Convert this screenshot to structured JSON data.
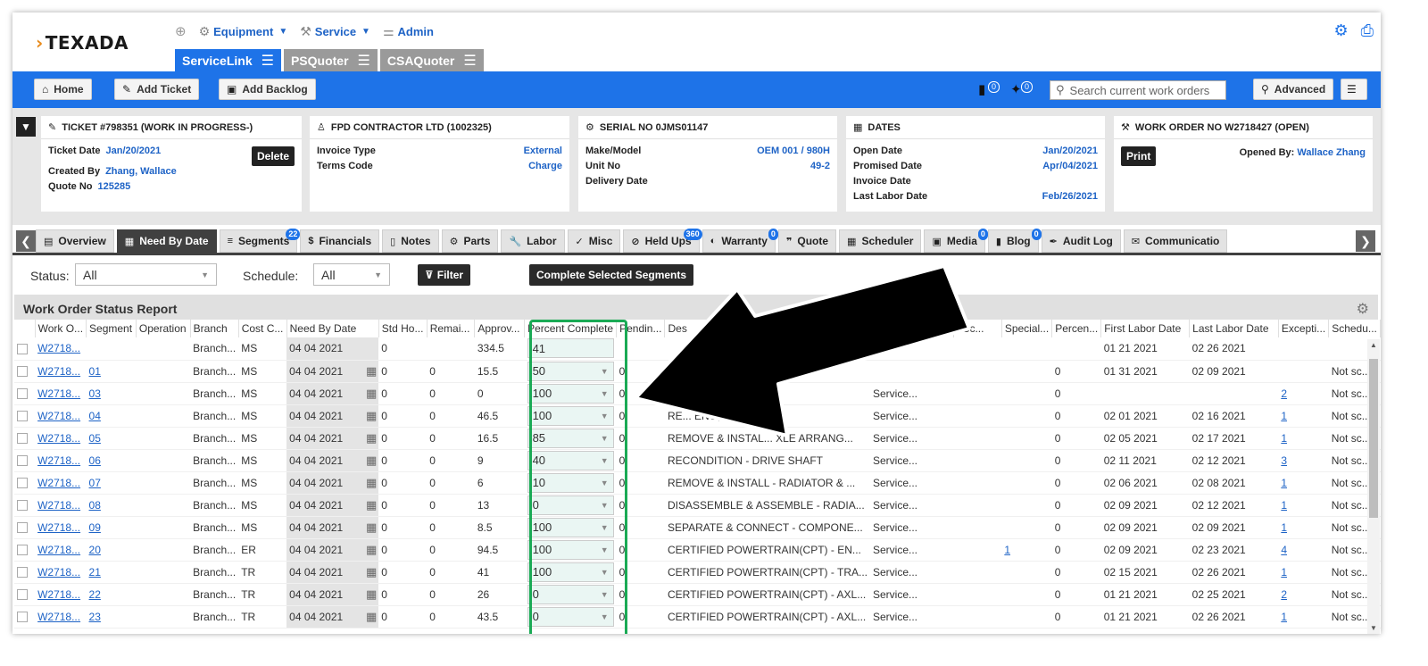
{
  "brand": {
    "logo": "TEXADA"
  },
  "topnav": [
    {
      "label": "Equipment",
      "icon": "gear-link-icon",
      "caret": true
    },
    {
      "label": "Service",
      "icon": "tools-icon",
      "caret": true
    },
    {
      "label": "Admin",
      "icon": "sliders-icon",
      "caret": false
    }
  ],
  "app_tabs": [
    {
      "label": "ServiceLink",
      "active": true
    },
    {
      "label": "PSQuoter",
      "active": false
    },
    {
      "label": "CSAQuoter",
      "active": false
    }
  ],
  "toolbar": {
    "home": "Home",
    "add_ticket": "Add Ticket",
    "add_backlog": "Add Backlog",
    "badge1": "0",
    "badge2": "0",
    "search_placeholder": "Search current work orders",
    "advanced": "Advanced"
  },
  "cards": {
    "ticket": {
      "title": "TICKET #798351 (WORK IN PROGRESS-)",
      "ticket_date_label": "Ticket Date",
      "ticket_date": "Jan/20/2021",
      "created_by_label": "Created By",
      "created_by": "Zhang, Wallace",
      "quote_no_label": "Quote No",
      "quote_no": "125285",
      "delete": "Delete"
    },
    "customer": {
      "title": "FPD CONTRACTOR LTD (1002325)",
      "invoice_type_label": "Invoice Type",
      "invoice_type": "External",
      "terms_code_label": "Terms Code",
      "terms_code": "Charge"
    },
    "serial": {
      "title": "SERIAL NO 0JMS01147",
      "make_model_label": "Make/Model",
      "make_model": "OEM 001 / 980H",
      "unit_no_label": "Unit No",
      "unit_no": "49-2",
      "delivery_date_label": "Delivery Date"
    },
    "dates": {
      "title": "DATES",
      "open_date_label": "Open Date",
      "open_date": "Jan/20/2021",
      "promised_date_label": "Promised Date",
      "promised_date": "Apr/04/2021",
      "invoice_date_label": "Invoice Date",
      "last_labor_label": "Last Labor Date",
      "last_labor": "Feb/26/2021"
    },
    "work_order": {
      "title": "WORK ORDER NO W2718427 (OPEN)",
      "print": "Print",
      "opened_by_label": "Opened By:",
      "opened_by": "Wallace Zhang"
    }
  },
  "tabs": [
    {
      "label": "Overview",
      "icon": "clipboard-icon"
    },
    {
      "label": "Need By Date",
      "icon": "calendar-icon",
      "active": true
    },
    {
      "label": "Segments",
      "icon": "list-icon",
      "badge": "22"
    },
    {
      "label": "Financials",
      "icon": "money-icon"
    },
    {
      "label": "Notes",
      "icon": "note-icon"
    },
    {
      "label": "Parts",
      "icon": "parts-icon"
    },
    {
      "label": "Labor",
      "icon": "wrench-icon"
    },
    {
      "label": "Misc",
      "icon": "misc-icon"
    },
    {
      "label": "Held Ups",
      "icon": "ban-icon",
      "badge": "360"
    },
    {
      "label": "Warranty",
      "icon": "shield-icon",
      "badge": "0"
    },
    {
      "label": "Quote",
      "icon": "quote-icon"
    },
    {
      "label": "Scheduler",
      "icon": "grid-calendar-icon"
    },
    {
      "label": "Media",
      "icon": "image-icon",
      "badge": "0"
    },
    {
      "label": "Blog",
      "icon": "book-icon",
      "badge": "0"
    },
    {
      "label": "Audit Log",
      "icon": "pen-icon"
    },
    {
      "label": "Communicatio",
      "icon": "mail-icon"
    }
  ],
  "filters": {
    "status_label": "Status:",
    "status_value": "All",
    "schedule_label": "Schedule:",
    "schedule_value": "All",
    "filter_btn": "Filter",
    "complete_btn": "Complete Selected Segments"
  },
  "report": {
    "title": "Work Order Status Report",
    "columns": [
      "Work O...",
      "Segment",
      "Operation",
      "Branch",
      "Cost C...",
      "Need By Date",
      "Std Ho...",
      "Remai...",
      "Approv...",
      "Percent Complete",
      "Pendin...",
      "Des",
      "",
      "t Sc...",
      "Special...",
      "Percen...",
      "First Labor Date",
      "Last Labor Date",
      "Excepti...",
      "Schedu..."
    ],
    "rows": [
      {
        "wo": "W2718...",
        "seg": "",
        "branch": "Branch...",
        "cost": "MS",
        "date": "04 04 2021",
        "std": "0",
        "rem": "",
        "appr": "334.5",
        "pct": "41",
        "pct_select": false,
        "pend": "",
        "desc": "",
        "svc": "",
        "sc": "",
        "spec": "",
        "perc": "",
        "first": "01 21 2021",
        "last": "02 26 2021",
        "exc": "",
        "sched": ""
      },
      {
        "wo": "W2718...",
        "seg": "01",
        "branch": "Branch...",
        "cost": "MS",
        "date": "04 04 2021",
        "std": "0",
        "rem": "0",
        "appr": "15.5",
        "pct": "50",
        "pct_select": true,
        "pend": "0",
        "desc": "",
        "svc": "",
        "sc": "",
        "spec": "",
        "perc": "0",
        "first": "01 31 2021",
        "last": "02 09 2021",
        "exc": "",
        "sched": "Not sc..."
      },
      {
        "wo": "W2718...",
        "seg": "03",
        "branch": "Branch...",
        "cost": "MS",
        "date": "04 04 2021",
        "std": "0",
        "rem": "0",
        "appr": "0",
        "pct": "100",
        "pct_select": true,
        "pend": "0",
        "desc": "",
        "svc": "Service...",
        "sc": "",
        "spec": "",
        "perc": "0",
        "first": "",
        "last": "",
        "exc": "2",
        "sched": "Not sc..."
      },
      {
        "wo": "W2718...",
        "seg": "04",
        "branch": "Branch...",
        "cost": "MS",
        "date": "04 04 2021",
        "std": "0",
        "rem": "0",
        "appr": "46.5",
        "pct": "100",
        "pct_select": true,
        "pend": "0",
        "desc": "RE... ENG, TC, TRAN...",
        "svc": "Service...",
        "sc": "",
        "spec": "",
        "perc": "0",
        "first": "02 01 2021",
        "last": "02 16 2021",
        "exc": "1",
        "sched": "Not sc..."
      },
      {
        "wo": "W2718...",
        "seg": "05",
        "branch": "Branch...",
        "cost": "MS",
        "date": "04 04 2021",
        "std": "0",
        "rem": "0",
        "appr": "16.5",
        "pct": "85",
        "pct_select": true,
        "pend": "0",
        "desc": "REMOVE & INSTAL... XLE ARRANG...",
        "svc": "Service...",
        "sc": "",
        "spec": "",
        "perc": "0",
        "first": "02 05 2021",
        "last": "02 17 2021",
        "exc": "1",
        "sched": "Not sc..."
      },
      {
        "wo": "W2718...",
        "seg": "06",
        "branch": "Branch...",
        "cost": "MS",
        "date": "04 04 2021",
        "std": "0",
        "rem": "0",
        "appr": "9",
        "pct": "40",
        "pct_select": true,
        "pend": "0",
        "desc": "RECONDITION - DRIVE SHAFT",
        "svc": "Service...",
        "sc": "",
        "spec": "",
        "perc": "0",
        "first": "02 11 2021",
        "last": "02 12 2021",
        "exc": "3",
        "sched": "Not sc..."
      },
      {
        "wo": "W2718...",
        "seg": "07",
        "branch": "Branch...",
        "cost": "MS",
        "date": "04 04 2021",
        "std": "0",
        "rem": "0",
        "appr": "6",
        "pct": "10",
        "pct_select": true,
        "pend": "0",
        "desc": "REMOVE & INSTALL - RADIATOR & ...",
        "svc": "Service...",
        "sc": "",
        "spec": "",
        "perc": "0",
        "first": "02 06 2021",
        "last": "02 08 2021",
        "exc": "1",
        "sched": "Not sc..."
      },
      {
        "wo": "W2718...",
        "seg": "08",
        "branch": "Branch...",
        "cost": "MS",
        "date": "04 04 2021",
        "std": "0",
        "rem": "0",
        "appr": "13",
        "pct": "0",
        "pct_select": true,
        "pend": "0",
        "desc": "DISASSEMBLE & ASSEMBLE - RADIA...",
        "svc": "Service...",
        "sc": "",
        "spec": "",
        "perc": "0",
        "first": "02 09 2021",
        "last": "02 12 2021",
        "exc": "1",
        "sched": "Not sc..."
      },
      {
        "wo": "W2718...",
        "seg": "09",
        "branch": "Branch...",
        "cost": "MS",
        "date": "04 04 2021",
        "std": "0",
        "rem": "0",
        "appr": "8.5",
        "pct": "100",
        "pct_select": true,
        "pend": "0",
        "desc": "SEPARATE & CONNECT - COMPONE...",
        "svc": "Service...",
        "sc": "",
        "spec": "",
        "perc": "0",
        "first": "02 09 2021",
        "last": "02 09 2021",
        "exc": "1",
        "sched": "Not sc..."
      },
      {
        "wo": "W2718...",
        "seg": "20",
        "branch": "Branch...",
        "cost": "ER",
        "date": "04 04 2021",
        "std": "0",
        "rem": "0",
        "appr": "94.5",
        "pct": "100",
        "pct_select": true,
        "pend": "0",
        "desc": "CERTIFIED POWERTRAIN(CPT) - EN...",
        "svc": "Service...",
        "sc": "",
        "spec": "1",
        "perc": "0",
        "first": "02 09 2021",
        "last": "02 23 2021",
        "exc": "4",
        "sched": "Not sc..."
      },
      {
        "wo": "W2718...",
        "seg": "21",
        "branch": "Branch...",
        "cost": "TR",
        "date": "04 04 2021",
        "std": "0",
        "rem": "0",
        "appr": "41",
        "pct": "100",
        "pct_select": true,
        "pend": "0",
        "desc": "CERTIFIED POWERTRAIN(CPT) - TRA...",
        "svc": "Service...",
        "sc": "",
        "spec": "",
        "perc": "0",
        "first": "02 15 2021",
        "last": "02 26 2021",
        "exc": "1",
        "sched": "Not sc..."
      },
      {
        "wo": "W2718...",
        "seg": "22",
        "branch": "Branch...",
        "cost": "TR",
        "date": "04 04 2021",
        "std": "0",
        "rem": "0",
        "appr": "26",
        "pct": "0",
        "pct_select": true,
        "pend": "0",
        "desc": "CERTIFIED POWERTRAIN(CPT) - AXL...",
        "svc": "Service...",
        "sc": "",
        "spec": "",
        "perc": "0",
        "first": "01 21 2021",
        "last": "02 25 2021",
        "exc": "2",
        "sched": "Not sc..."
      },
      {
        "wo": "W2718...",
        "seg": "23",
        "branch": "Branch...",
        "cost": "TR",
        "date": "04 04 2021",
        "std": "0",
        "rem": "0",
        "appr": "43.5",
        "pct": "0",
        "pct_select": true,
        "pend": "0",
        "desc": "CERTIFIED POWERTRAIN(CPT) - AXL...",
        "svc": "Service...",
        "sc": "",
        "spec": "",
        "perc": "0",
        "first": "01 21 2021",
        "last": "02 26 2021",
        "exc": "1",
        "sched": "Not sc..."
      }
    ]
  },
  "colors": {
    "primary_blue": "#1e73e8",
    "link_blue": "#1e63c6",
    "highlight_green": "#1aaa55",
    "tab_active": "#404040"
  }
}
